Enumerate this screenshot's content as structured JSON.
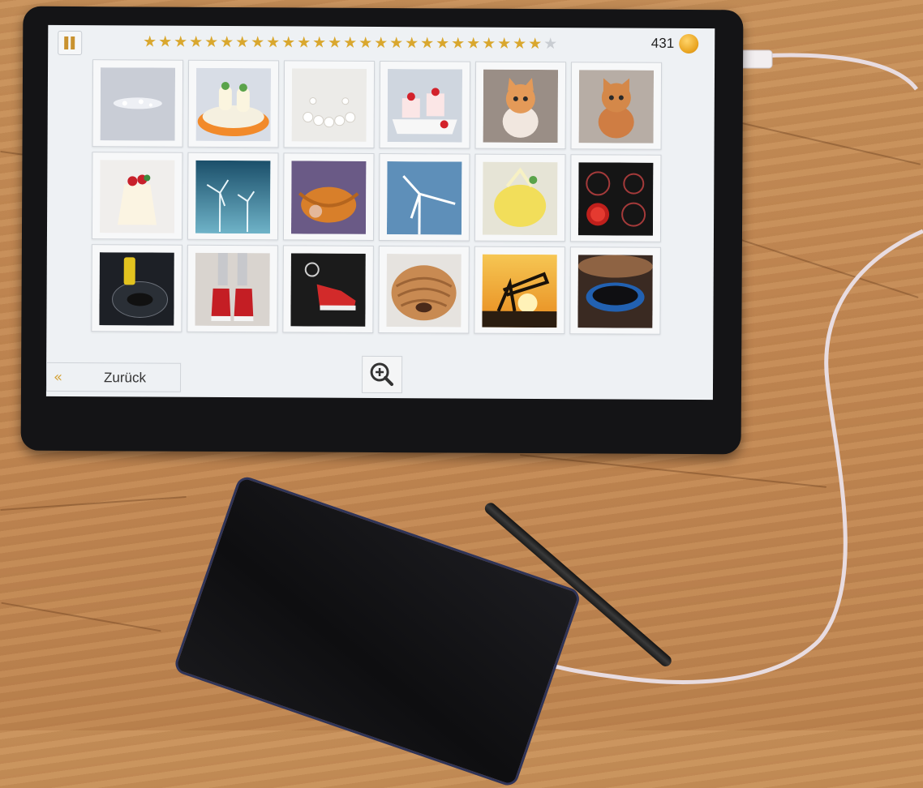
{
  "game": {
    "menu_icon": "pause-bars-icon",
    "stars_filled": 26,
    "stars_total": 27,
    "coins": "431",
    "coin_icon": "coin-icon",
    "back_arrows": "«",
    "back_label": "Zurück",
    "zoom_icon": "zoom-in-icon",
    "tiles": [
      {
        "name": "tile-crystal-stones",
        "desc": "crystals"
      },
      {
        "name": "tile-lemon-dessert",
        "desc": "lemon dessert"
      },
      {
        "name": "tile-pearl-necklace",
        "desc": "pearls"
      },
      {
        "name": "tile-strawberry-cakes",
        "desc": "cakes"
      },
      {
        "name": "tile-kitten-1",
        "desc": "kitten"
      },
      {
        "name": "tile-kitten-2",
        "desc": "kitten"
      },
      {
        "name": "tile-panna-cotta",
        "desc": "panna cotta"
      },
      {
        "name": "tile-wind-turbines-1",
        "desc": "wind turbines"
      },
      {
        "name": "tile-knitting",
        "desc": "knitting"
      },
      {
        "name": "tile-wind-turbine-2",
        "desc": "wind turbine"
      },
      {
        "name": "tile-lemon-pudding",
        "desc": "lemon pudding"
      },
      {
        "name": "tile-ceramic-hob",
        "desc": "ceramic hob"
      },
      {
        "name": "tile-fuel-cap",
        "desc": "fuel cap"
      },
      {
        "name": "tile-red-sneakers",
        "desc": "red sneakers"
      },
      {
        "name": "tile-sneaker-keychain",
        "desc": "sneaker keychain"
      },
      {
        "name": "tile-shar-pei-dog",
        "desc": "wrinkly dog"
      },
      {
        "name": "tile-oil-pump",
        "desc": "oil pump at sunset"
      },
      {
        "name": "tile-gas-burner",
        "desc": "gas burner flame"
      }
    ]
  },
  "colors": {
    "star": "#d9a72e",
    "star_empty": "#c9cdd2",
    "screen_bg": "#eef1f4",
    "table": "#c48a55"
  }
}
